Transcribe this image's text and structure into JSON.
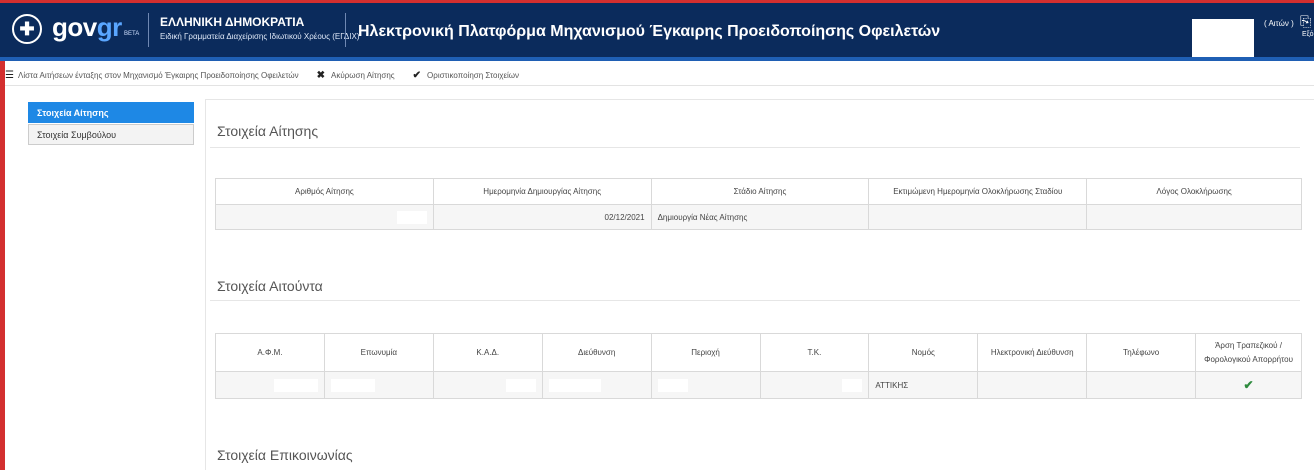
{
  "header": {
    "logo_seal": "✚",
    "logo_gov": "gov",
    "logo_gr": "gr",
    "logo_beta": "BETA",
    "ministry_title": "ΕΛΛΗΝΙΚΗ ΔΗΜΟΚΡΑΤΙΑ",
    "ministry_subtitle": "Ειδική Γραμματεία Διαχείρισης Ιδιωτικού Χρέους (ΕΓΔΙΧ)",
    "app_title": "Ηλεκτρονική Πλατφόρμα Μηχανισμού Έγκαιρης Προειδοποίησης Οφειλετών",
    "user_role": "( Αιτών )",
    "logout_label": "Εξό"
  },
  "actionbar": {
    "list_label": "Λίστα Αιτήσεων ένταξης στον Μηχανισμό Έγκαιρης Προειδοποίησης Οφειλετών",
    "cancel_label": "Ακύρωση Αίτησης",
    "finalize_label": "Οριστικοποίηση Στοιχείων"
  },
  "sidebar": {
    "items": [
      {
        "label": "Στοιχεία Αίτησης",
        "active": true
      },
      {
        "label": "Στοιχεία Συμβούλου",
        "active": false
      }
    ]
  },
  "sections": {
    "application": {
      "title": "Στοιχεία Αίτησης",
      "headers": [
        "Αριθμός Αίτησης",
        "Ημερομηνία Δημιουργίας Αίτησης",
        "Στάδιο Αίτησης",
        "Εκτιμώμενη Ημερομηνία Ολοκλήρωσης Σταδίου",
        "Λόγος Ολοκλήρωσης"
      ],
      "row": [
        "",
        "02/12/2021",
        "Δημιουργία Νέας Αίτησης",
        "",
        ""
      ]
    },
    "applicant": {
      "title": "Στοιχεία Αιτούντα",
      "headers": [
        "Α.Φ.Μ.",
        "Επωνυμία",
        "Κ.Α.Δ.",
        "Διεύθυνση",
        "Περιοχή",
        "Τ.Κ.",
        "Νομός",
        "Ηλεκτρονική Διεύθυνση",
        "Τηλέφωνο",
        "Άρση Τραπεζικού / Φορολογικού Απορρήτου"
      ],
      "row": [
        "",
        "",
        "",
        "",
        "",
        "",
        "ΑΤΤΙΚΗΣ",
        "",
        "",
        "✔"
      ]
    },
    "contact": {
      "title": "Στοιχεία Επικοινωνίας"
    }
  }
}
